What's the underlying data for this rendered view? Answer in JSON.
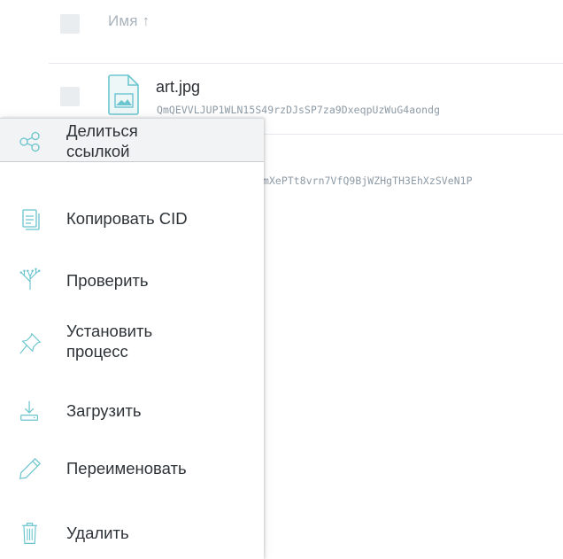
{
  "table": {
    "header": {
      "name_label": "Имя ↑"
    },
    "rows": [
      {
        "name": "art.jpg",
        "cid": "QmQEVVLJUP1WLN15S49rzDJsSP7za9DxeqpUzWuG4aondg"
      },
      {
        "name": "",
        "cid": "mXePTt8vrn7VfQ9BjWZHgTH3EhXzSVeN1P"
      }
    ]
  },
  "context_menu": {
    "items": [
      {
        "label": "Делиться\nссылкой",
        "icon": "share-icon"
      },
      {
        "label": "Копировать CID",
        "icon": "copy-icon"
      },
      {
        "label": "Проверить",
        "icon": "inspect-icon"
      },
      {
        "label": "Установить\nпроцесс",
        "icon": "pin-icon"
      },
      {
        "label": "Загрузить",
        "icon": "download-icon"
      },
      {
        "label": "Переименовать",
        "icon": "pencil-icon"
      },
      {
        "label": "Удалить",
        "icon": "trash-icon"
      }
    ]
  },
  "colors": {
    "accent": "#69c4cd",
    "text": "#2e3338",
    "muted": "#a9b3bb"
  }
}
